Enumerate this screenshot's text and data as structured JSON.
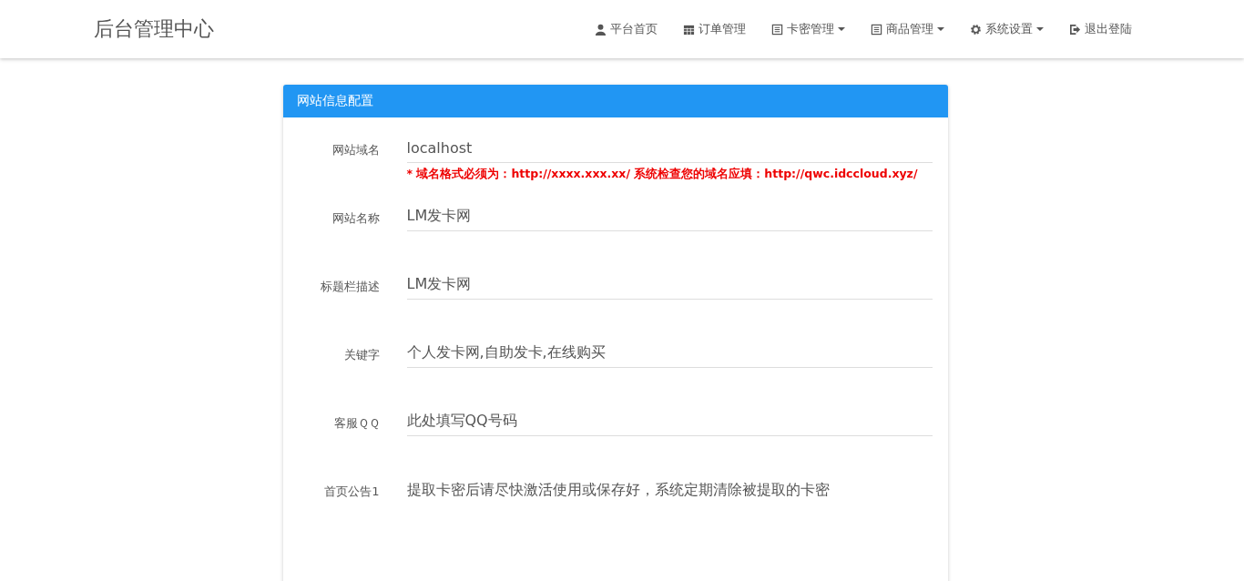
{
  "brand": "后台管理中心",
  "nav": [
    {
      "label": "平台首页",
      "dropdown": false
    },
    {
      "label": "订单管理",
      "dropdown": false
    },
    {
      "label": "卡密管理",
      "dropdown": true
    },
    {
      "label": "商品管理",
      "dropdown": true
    },
    {
      "label": "系统设置",
      "dropdown": true
    },
    {
      "label": "退出登陆",
      "dropdown": false
    }
  ],
  "panel": {
    "title": "网站信息配置",
    "fields": [
      {
        "label": "网站域名",
        "kind": "input",
        "value": "localhost",
        "hint": "* 域名格式必须为：http://xxxx.xxx.xx/ 系统检查您的域名应填：http://qwc.idccloud.xyz/"
      },
      {
        "label": "网站名称",
        "kind": "input",
        "value": "LM发卡网"
      },
      {
        "label": "标题栏描述",
        "kind": "input",
        "value": "LM发卡网"
      },
      {
        "label": "关键字",
        "kind": "input",
        "value": "个人发卡网,自助发卡,在线购买"
      },
      {
        "label": "客服ＱＱ",
        "kind": "input",
        "value": "此处填写QQ号码"
      },
      {
        "label": "首页公告1",
        "kind": "textarea",
        "value": "提取卡密后请尽快激活使用或保存好，系统定期清除被提取的卡密"
      }
    ]
  }
}
